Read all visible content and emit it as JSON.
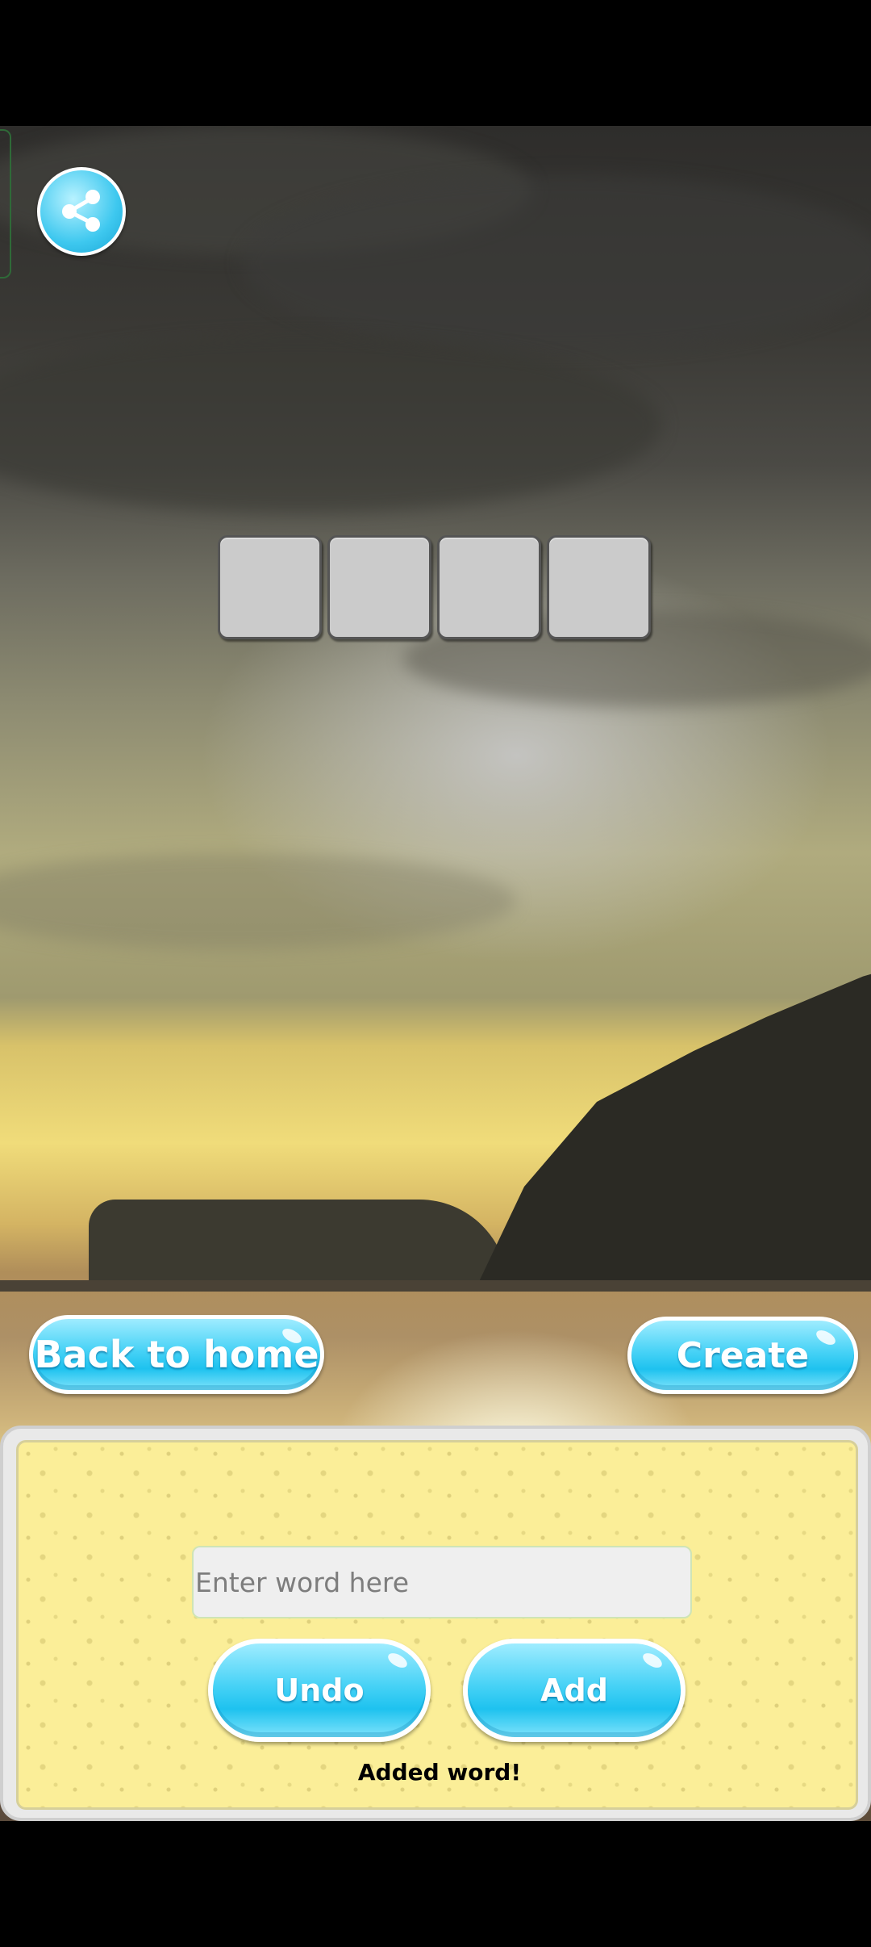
{
  "header": {
    "share_icon": "share-icon"
  },
  "puzzle": {
    "tile_count": 4
  },
  "actions": {
    "back_label": "Back to home",
    "create_label": "Create"
  },
  "editor": {
    "input_placeholder": "Enter word here",
    "input_value": "",
    "undo_label": "Undo",
    "add_label": "Add",
    "status_text": "Added word!"
  },
  "colors": {
    "button_blue": "#47d2f6",
    "panel_yellow": "#fbee98",
    "tile_gray": "#cbcbcb"
  }
}
